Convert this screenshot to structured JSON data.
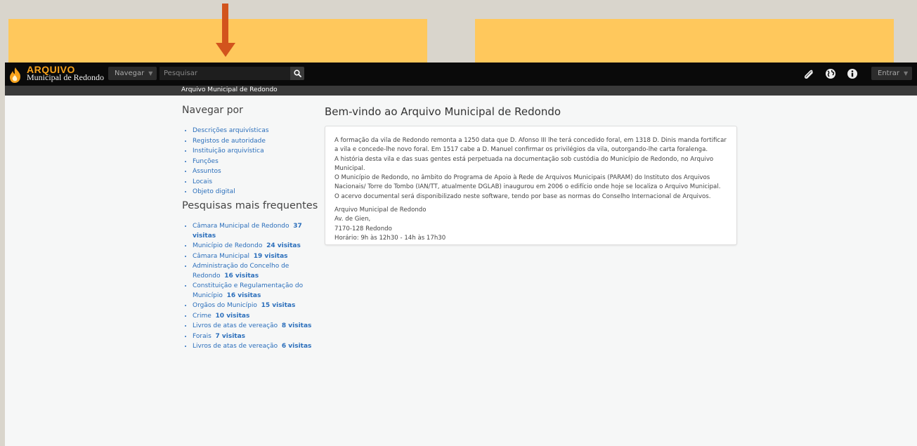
{
  "app": {
    "logo_title": "ARQUIVO",
    "logo_subtitle": "Municipal de Redondo"
  },
  "topbar": {
    "browse_label": "Navegar",
    "search_placeholder": "Pesquisar",
    "icons": [
      "clipboard-icon",
      "globe-icon",
      "info-icon"
    ],
    "login_label": "Entrar"
  },
  "breadcrumb": "Arquivo Municipal de Redondo",
  "sidebar": {
    "browse_title": "Navegar por",
    "browse_items": [
      "Descrições arquivísticas",
      "Registos de autoridade",
      "Instituição arquivística",
      "Funções",
      "Assuntos",
      "Locais",
      "Objeto digital"
    ],
    "popular_title": "Pesquisas mais frequentes",
    "popular_items": [
      {
        "label": "Câmara Municipal de Redondo",
        "count": "37 visitas"
      },
      {
        "label": "Município de Redondo",
        "count": "24 visitas"
      },
      {
        "label": "Câmara Municipal",
        "count": "19 visitas"
      },
      {
        "label": "Administração do Concelho de Redondo",
        "count": "16 visitas"
      },
      {
        "label": "Constituição e Regulamentação do Município",
        "count": "16 visitas"
      },
      {
        "label": "Orgãos do Município",
        "count": "15 visitas"
      },
      {
        "label": "Crime",
        "count": "10 visitas"
      },
      {
        "label": "Livros de atas de vereação",
        "count": "8 visitas"
      },
      {
        "label": "Forais",
        "count": "7 visitas"
      },
      {
        "label": "Livros de atas de vereação",
        "count": "6 visitas"
      }
    ]
  },
  "main": {
    "title": "Bem-vindo ao Arquivo Municipal de Redondo",
    "paragraphs": [
      "A formação da vila de Redondo remonta a 1250 data que D. Afonso III lhe terá concedido foral, em 1318 D. Dinis manda fortificar a vila e concede-lhe novo foral. Em 1517 cabe a D. Manuel confirmar os privilégios da vila, outorgando-lhe carta foralenga.",
      "A história desta vila e das suas gentes está perpetuada na documentação sob custódia do Município de Redondo, no Arquivo Municipal.",
      "O Município de Redondo, no âmbito do Programa de Apoio à Rede de Arquivos Municipais (PARAM) do Instituto dos Arquivos Nacionais/ Torre do Tombo (IAN/TT, atualmente DGLAB) inaugurou em 2006 o edifício onde hoje se localiza o Arquivo Municipal.",
      "O acervo documental será disponibilizado neste software, tendo por base as normas do Conselho Internacional de Arquivos."
    ],
    "address": [
      "Arquivo Municipal de Redondo",
      "Av. de Gien,",
      "7170-128 Redondo",
      "Horário: 9h às 12h30 - 14h às 17h30"
    ]
  },
  "colors": {
    "topbar": "#0a0a0a",
    "banner": "#ffc85c",
    "arrow": "#d2541d",
    "link": "#2a6ebb",
    "logo_accent": "#f7a21b"
  }
}
